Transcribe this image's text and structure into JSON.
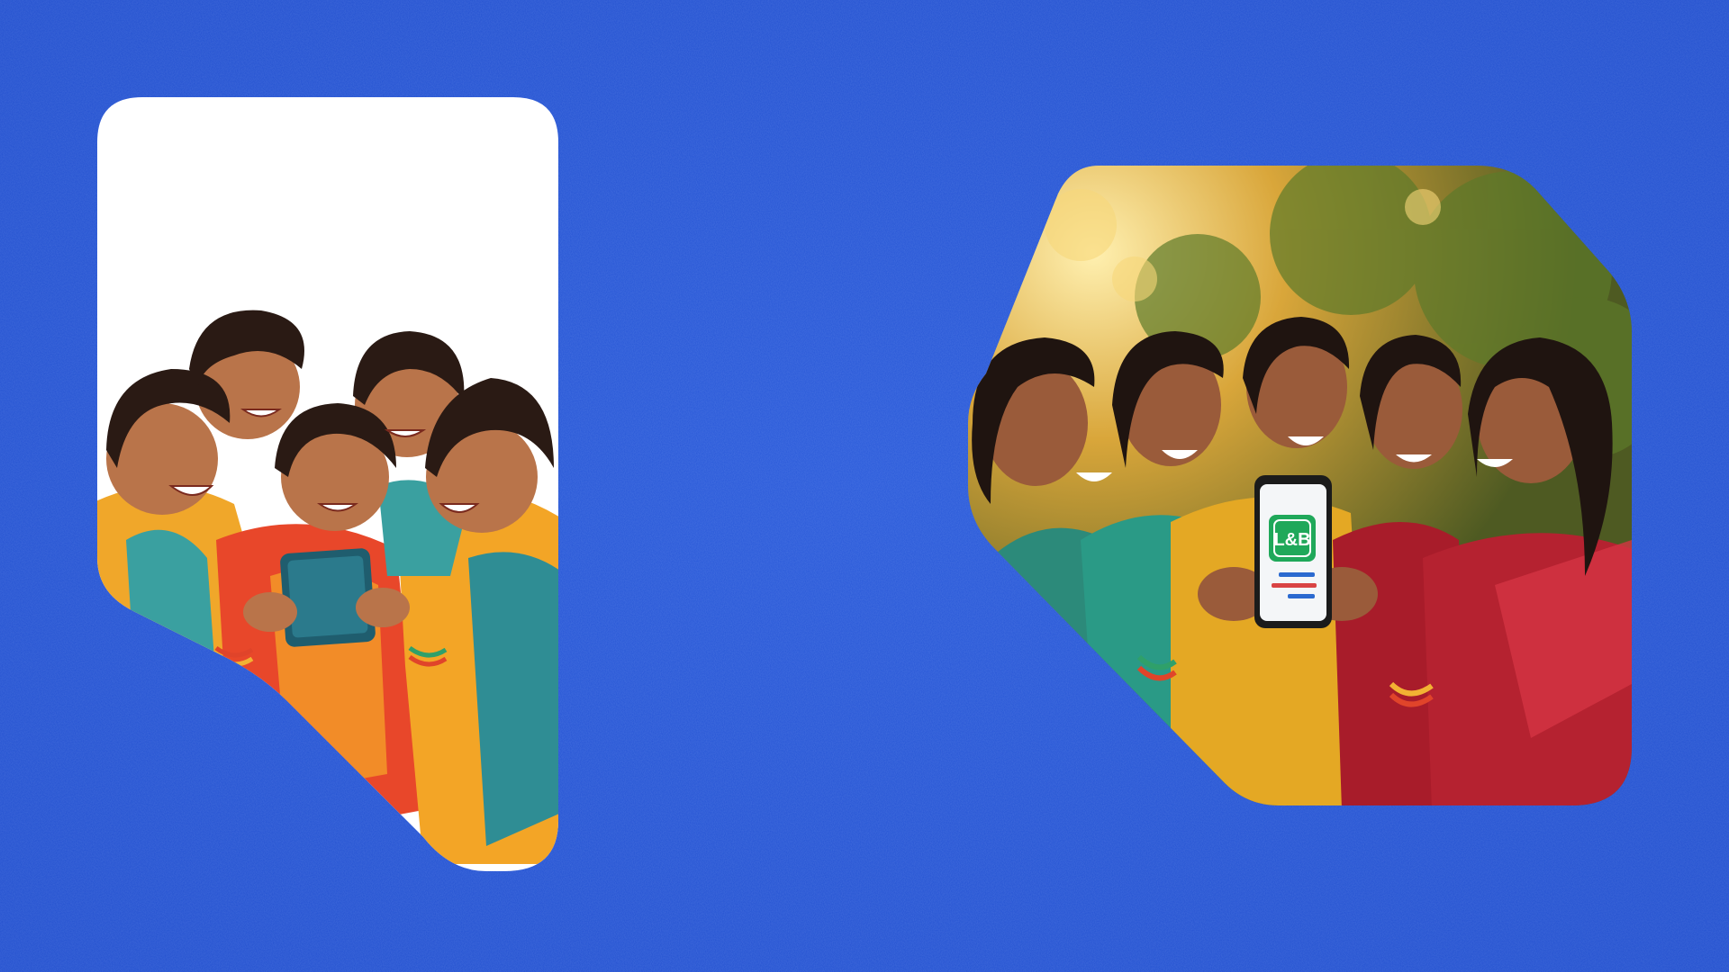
{
  "background": {
    "color": "#2a5ad8",
    "color_dark": "#2452cc",
    "speckle": "#5b82e6"
  },
  "left_panel": {
    "description_icon": "illustration-kids-tablet",
    "frame_color": "#ffffff"
  },
  "right_panel": {
    "description_icon": "photo-women-phone",
    "app_logo": {
      "text": "L&B",
      "color": "#1fa85a"
    }
  }
}
